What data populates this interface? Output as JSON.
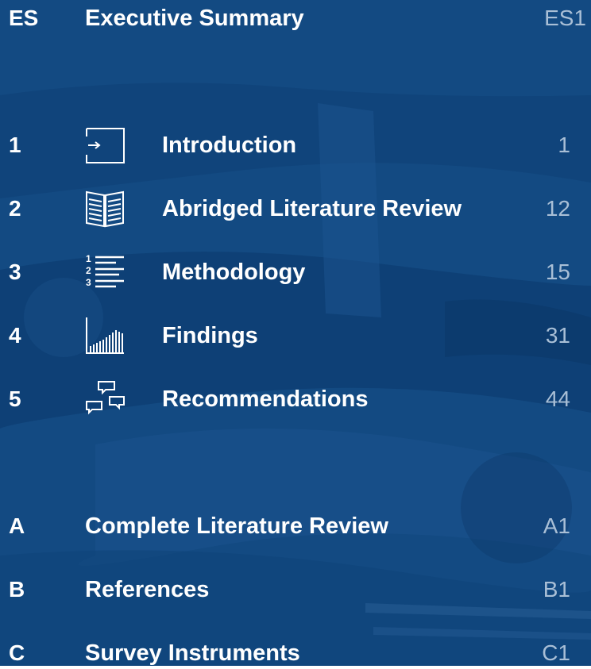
{
  "colors": {
    "background": "#134a82",
    "background_dark": "#0c3a6c",
    "text": "#ffffff",
    "page_number": "#a9bfd6"
  },
  "toc": {
    "front": {
      "label": "ES",
      "title": "Executive Summary",
      "page": "ES1"
    },
    "chapters": [
      {
        "number": "1",
        "title": "Introduction",
        "page": "1",
        "icon": "enter-arrow-icon"
      },
      {
        "number": "2",
        "title": "Abridged Literature Review",
        "page": "12",
        "icon": "open-book-icon"
      },
      {
        "number": "3",
        "title": "Methodology",
        "page": "15",
        "icon": "numbered-list-icon"
      },
      {
        "number": "4",
        "title": "Findings",
        "page": "31",
        "icon": "bar-chart-icon"
      },
      {
        "number": "5",
        "title": "Recommendations",
        "page": "44",
        "icon": "speech-bubbles-icon"
      }
    ],
    "appendices": [
      {
        "letter": "A",
        "title": "Complete Literature Review",
        "page": "A1"
      },
      {
        "letter": "B",
        "title": "References",
        "page": "B1"
      },
      {
        "letter": "C",
        "title": "Survey Instruments",
        "page": "C1"
      }
    ]
  }
}
